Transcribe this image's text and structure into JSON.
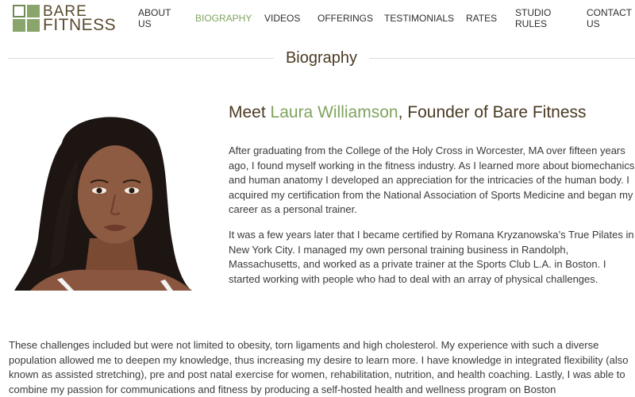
{
  "brand": {
    "line1": "BARE",
    "line2": "FITNESS",
    "accent_color": "#7fa35e",
    "text_color": "#5a4a2e"
  },
  "nav": {
    "items": [
      {
        "label": "ABOUT\nUS"
      },
      {
        "label": "BIOGRAPHY"
      },
      {
        "label": "VIDEOS"
      },
      {
        "label": "OFFERINGS"
      },
      {
        "label": "TESTIMONIALS"
      },
      {
        "label": "RATES"
      },
      {
        "label": "STUDIO\nRULES"
      },
      {
        "label": "CONTACT\nUS"
      }
    ],
    "active": "BIOGRAPHY"
  },
  "section": {
    "title": "Biography"
  },
  "bio": {
    "headline_prefix": "Meet ",
    "headline_name": "Laura Williamson",
    "headline_suffix": ", Founder of Bare Fitness",
    "paragraph1": "After graduating from the College of the Holy Cross in Worcester, MA over fifteen years ago, I found myself working in the fitness industry. As I learned more about biomechanics and human anatomy I developed an appreciation for the intricacies of the human body. I acquired my certification from the National Association of Sports Medicine and began my career as a personal trainer.",
    "paragraph2": "It was a few years later that I became certified by Romana Kryzanowska’s True Pilates in New York City.  I managed my own personal training business in Randolph, Massachusetts, and worked as a private trainer at the Sports Club L.A. in Boston.  I started working with people who had to deal with an array of physical challenges.",
    "paragraph3": "These challenges included but were not limited to obesity, torn ligaments and high cholesterol.  My experience with such a diverse population allowed me to deepen my knowledge, thus increasing my desire to learn more.  I have knowledge in integrated flexibility (also known as assisted stretching), pre and post natal exercise for women, rehabilitation, nutrition, and health coaching. Lastly, I was able to combine my passion for communications and fitness by producing a self-hosted health and wellness program on Boston"
  }
}
